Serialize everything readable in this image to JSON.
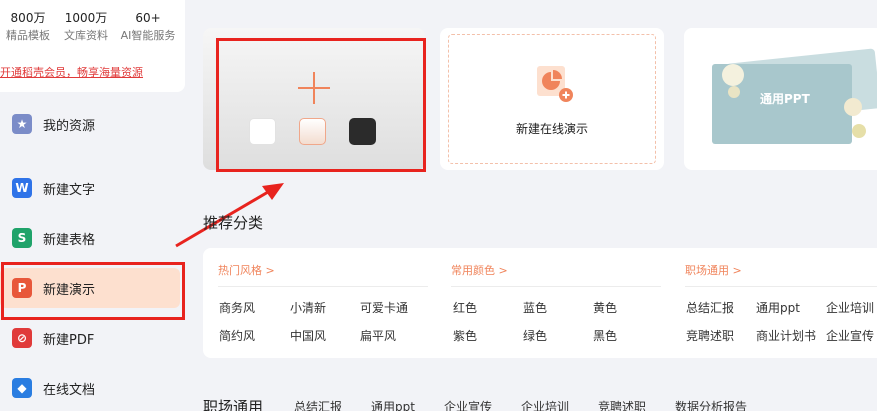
{
  "sidebar": {
    "stats": [
      {
        "num": "800万",
        "label": "精品模板"
      },
      {
        "num": "1000万",
        "label": "文库资料"
      },
      {
        "num": "60+",
        "label": "AI智能服务"
      }
    ],
    "promo_link": "开通稻壳会员，畅享海量资源",
    "items": [
      {
        "label": "我的资源",
        "icon": "star-icon",
        "color": "#7b8cc8"
      },
      {
        "label": "新建文字",
        "icon": "wps-writer-icon",
        "color": "#2f73e8"
      },
      {
        "label": "新建表格",
        "icon": "wps-sheet-icon",
        "color": "#1fa36a"
      },
      {
        "label": "新建演示",
        "icon": "wps-presentation-icon",
        "color": "#e8573a"
      },
      {
        "label": "新建PDF",
        "icon": "pdf-icon",
        "color": "#e03a3a"
      },
      {
        "label": "在线文档",
        "icon": "online-doc-icon",
        "color": "#2a7de1"
      }
    ]
  },
  "cards": {
    "online_label": "新建在线演示",
    "ppt_template_title": "通用PPT"
  },
  "swatches": [
    "#ffffff",
    "#f7e6dd",
    "#2b2b2b"
  ],
  "recommend": {
    "title": "推荐分类",
    "groups": [
      {
        "head": "热门风格 >",
        "tags": [
          "商务风",
          "小清新",
          "可爱卡通",
          "简约风",
          "中国风",
          "扁平风"
        ]
      },
      {
        "head": "常用颜色 >",
        "tags": [
          "红色",
          "蓝色",
          "黄色",
          "紫色",
          "绿色",
          "黑色"
        ]
      },
      {
        "head": "职场通用 >",
        "tags": [
          "总结汇报",
          "通用ppt",
          "企业培训",
          "竞聘述职",
          "商业计划书",
          "企业宣传"
        ]
      }
    ]
  },
  "bottom": {
    "title": "职场通用",
    "tags": [
      "总结汇报",
      "通用ppt",
      "企业宣传",
      "企业培训",
      "竞聘述职",
      "数据分析报告"
    ]
  },
  "accent": "#f0845b",
  "highlight": "#e8231e"
}
